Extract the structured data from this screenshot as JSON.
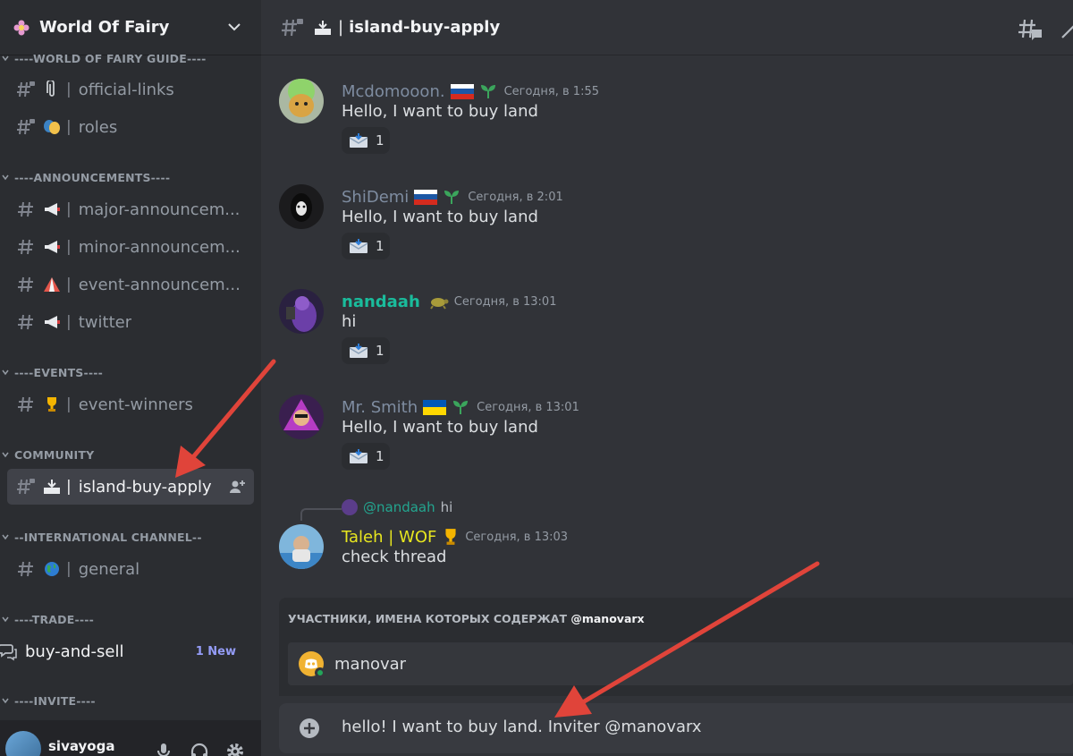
{
  "server": {
    "name": "World Of Fairy"
  },
  "sidebar": {
    "categories": {
      "guide": "----WORLD OF FAIRY GUIDE----",
      "announcements": "----ANNOUNCEMENTS----",
      "events": "----EVENTS----",
      "community": "COMMUNITY",
      "international": "--INTERNATIONAL CHANNEL--",
      "trade": "----TRADE----",
      "invite": "----INVITE----"
    },
    "channels": {
      "official_links": "official-links",
      "roles": "roles",
      "major": "major-announcem...",
      "minor": "minor-announcem...",
      "event_ann": "event-announcem...",
      "twitter": "twitter",
      "event_winners": "event-winners",
      "island_buy_apply": "island-buy-apply",
      "general": "general",
      "buy_and_sell": "buy-and-sell",
      "buy_and_sell_badge": "1 New"
    },
    "separator": "|",
    "user": {
      "name": "sivayoga"
    }
  },
  "channel_header": {
    "title": "island-buy-apply",
    "separator": "|"
  },
  "messages": [
    {
      "author": "Mcdomooon.",
      "author_color": "#7e8ca0",
      "timestamp": "Сегодня, в 1:55",
      "text": "Hello, I want to buy land",
      "reaction_count": "1"
    },
    {
      "author": "ShiDemi",
      "author_color": "#7e8ca0",
      "timestamp": "Сегодня, в 2:01",
      "text": "Hello, I want to buy land",
      "reaction_count": "1"
    },
    {
      "author": "nandaah",
      "author_color": "#1abc9c",
      "timestamp": "Сегодня, в 13:01",
      "text": "hi",
      "reaction_count": "1"
    },
    {
      "author": "Mr. Smith",
      "author_color": "#7e8ca0",
      "timestamp": "Сегодня, в 13:01",
      "text": "Hello, I want to buy land",
      "reaction_count": "1"
    },
    {
      "author": "Taleh | WOF",
      "author_color": "#e7e61f",
      "timestamp": "Сегодня, в 13:03",
      "text": "check thread",
      "reply_mention": "@nandaah",
      "reply_text": "hi"
    }
  ],
  "autocomplete": {
    "title_prefix": "УЧАСТНИКИ, ИМЕНА КОТОРЫХ СОДЕРЖАТ",
    "title_query": "@manovarx",
    "result_name": "manovar"
  },
  "composer": {
    "value": "hello! I want to buy land. Inviter @manovarx"
  },
  "colors": {
    "accent_arrow": "#e0443a",
    "online": "#23a55a",
    "mention": "#23a58f",
    "new_badge": "#949cf7"
  }
}
